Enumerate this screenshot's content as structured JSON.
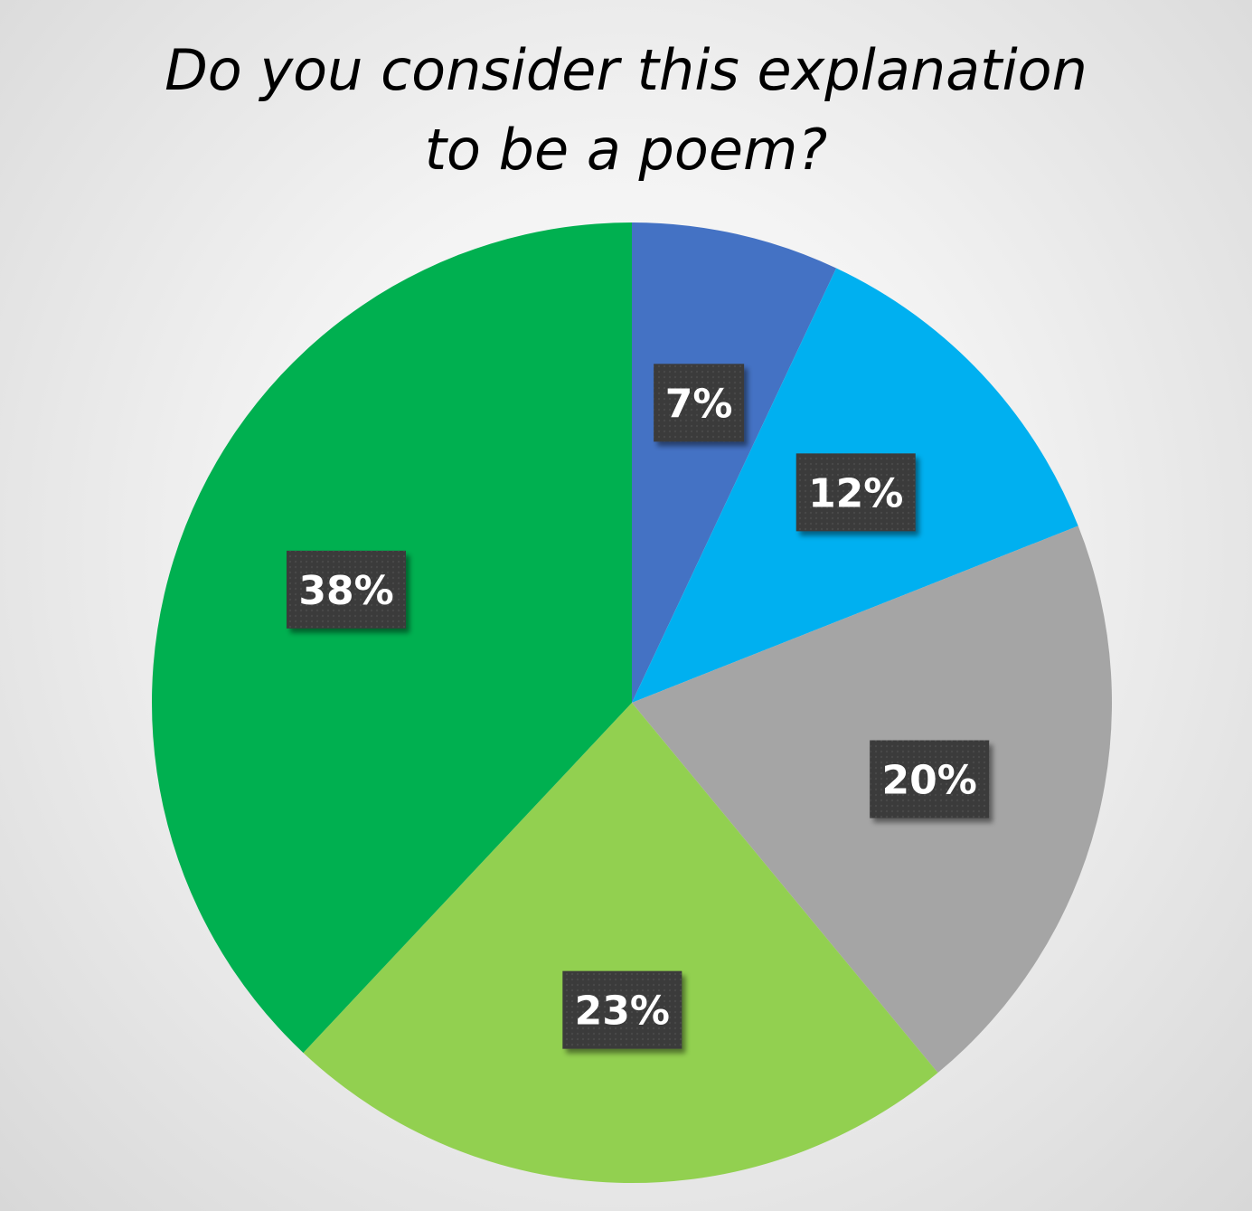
{
  "chart_data": {
    "type": "pie",
    "title": "Do you consider this explanation to be a poem?",
    "title_lines": [
      "Do you consider this explanation",
      "to be a poem?"
    ],
    "start": "12 o'clock",
    "direction": "clockwise",
    "slices": [
      {
        "value": 7,
        "label": "7%",
        "color": "#4472C4"
      },
      {
        "value": 12,
        "label": "12%",
        "color": "#00B0F0"
      },
      {
        "value": 20,
        "label": "20%",
        "color": "#A5A5A5"
      },
      {
        "value": 23,
        "label": "23%",
        "color": "#92D050"
      },
      {
        "value": 38,
        "label": "38%",
        "color": "#00B050"
      }
    ],
    "data_label_background": "#3a3a3a",
    "data_label_color": "#ffffff",
    "legend": "none"
  }
}
